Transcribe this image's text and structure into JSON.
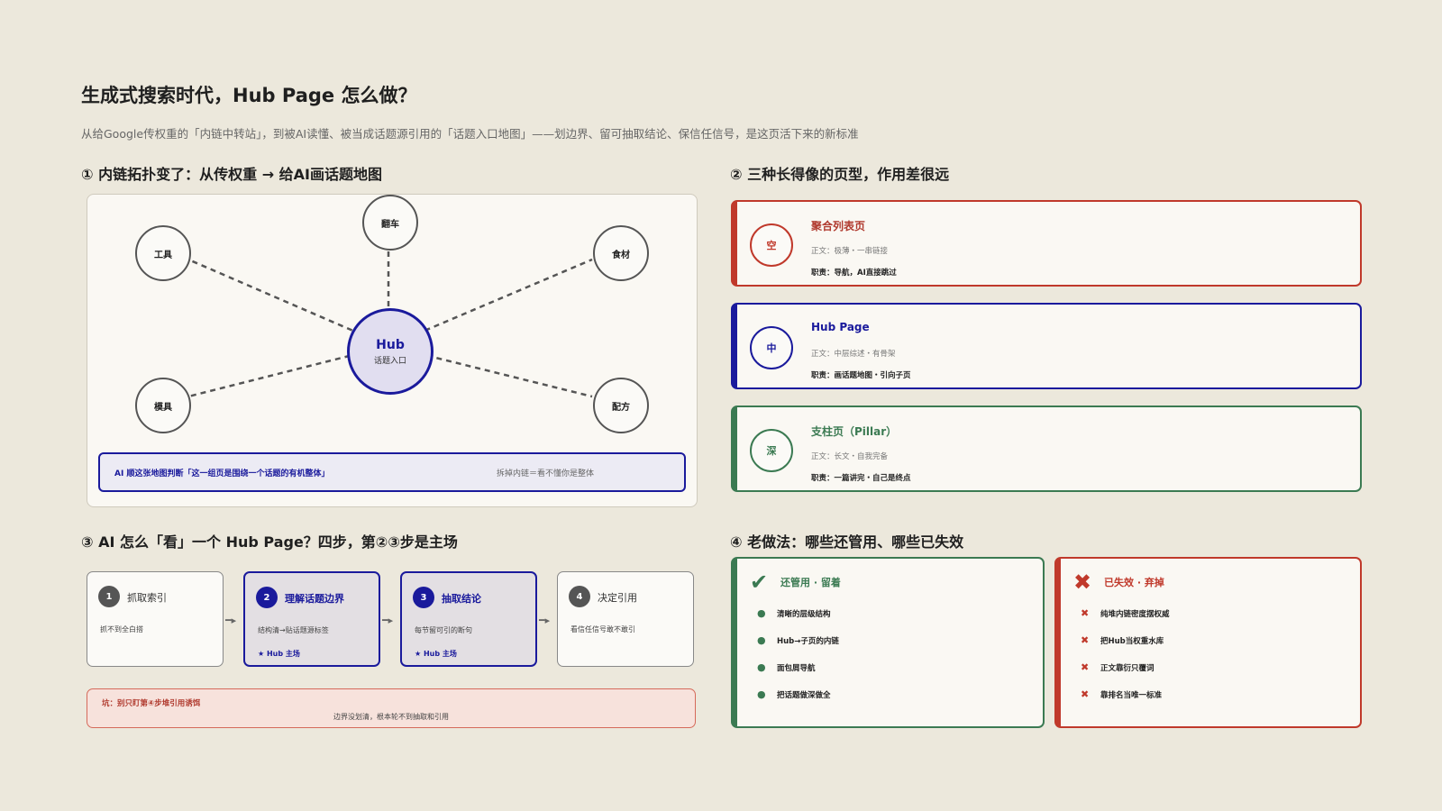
{
  "title": "生成式搜索时代，Hub Page 怎么做？",
  "subtitle": "从给Google传权重的「内链中转站」，到被AI读懂、被当成话题源引用的「话题入口地图」——划边界、留可抽取结论、保信任信号，是这页活下来的新标准",
  "section1": {
    "heading": "① 内链拓扑变了：从传权重 → 给AI画话题地图",
    "hub_label": "Hub",
    "hub_sub": "话题入口",
    "nodes": [
      "翻车",
      "工具",
      "食材",
      "模具",
      "配方"
    ],
    "note_left": "AI 顺这张地图判断「这一组页是围绕一个话题的有机整体」",
    "note_right": "拆掉内链＝看不懂你是整体"
  },
  "section2": {
    "heading": "② 三种长得像的页型，作用差很远",
    "cards": [
      {
        "badge": "空",
        "name": "聚合列表页",
        "body": "正文：极薄・一串链接",
        "role": "职责：导航，AI直接跳过",
        "color": "#c0392b"
      },
      {
        "badge": "中",
        "name": "Hub Page",
        "body": "正文：中层综述・有骨架",
        "role": "职责：画话题地图・引向子页",
        "color": "#1a1a9c"
      },
      {
        "badge": "深",
        "name": "支柱页（Pillar）",
        "body": "正文：长文・自我完备",
        "role": "职责：一篇讲完・自己是终点",
        "color": "#3b7a52"
      }
    ]
  },
  "section3": {
    "heading": "③ AI 怎么「看」一个 Hub Page？四步，第②③步是主场",
    "steps": [
      {
        "num": "1",
        "label": "抓取索引",
        "desc": "抓不到全白搭",
        "tag": ""
      },
      {
        "num": "2",
        "label": "理解话题边界",
        "desc": "结构清→贴话题源标签",
        "tag": "★ Hub 主场"
      },
      {
        "num": "3",
        "label": "抽取结论",
        "desc": "每节留可引的断句",
        "tag": "★ Hub 主场"
      },
      {
        "num": "4",
        "label": "决定引用",
        "desc": "看信任信号敢不敢引",
        "tag": ""
      }
    ],
    "pit_title": "坑：别只盯第④步堆引用诱饵",
    "pit_body": "边界没划清，根本轮不到抽取和引用"
  },
  "section4": {
    "heading": "④ 老做法：哪些还管用、哪些已失效",
    "keep_title": "还管用 · 留着",
    "keep_icon": "✔",
    "keep_items": [
      "清晰的层级结构",
      "Hub→子页的内链",
      "面包屑导航",
      "把话题做深做全"
    ],
    "drop_title": "已失效 · 弃掉",
    "drop_icon": "✖",
    "drop_items": [
      "纯堆内链密度摆权威",
      "把Hub当权重水库",
      "正文靠衍只覆词",
      "靠排名当唯一标准"
    ]
  }
}
